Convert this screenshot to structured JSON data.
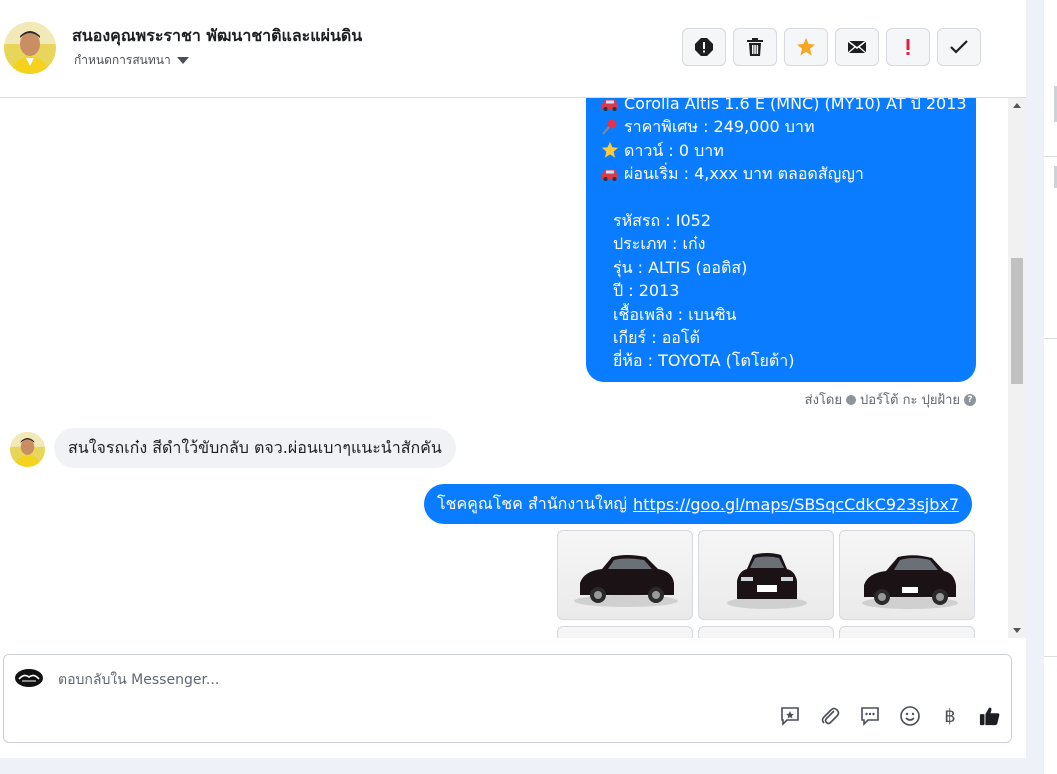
{
  "header": {
    "contact_name": "สนองคุณพระราชา พัฒนาชาติและแผ่นดิน",
    "manage_label": "กำหนดการสนทนา",
    "actions": [
      "alert-circle-icon",
      "trash-icon",
      "star-icon",
      "envelope-icon",
      "exclamation-icon",
      "check-icon"
    ]
  },
  "messages": {
    "listing": {
      "lines": [
        {
          "icon": "car-icon",
          "text": "Corolla Altis 1.6 E (MNC) (MY10) AT ปี 2013"
        },
        {
          "icon": "pushpin-icon",
          "text": "ราคาพิเศษ : 249,000 บาท"
        },
        {
          "icon": "star-icon",
          "text": "ดาวน์ : 0 บาท"
        },
        {
          "icon": "car-icon",
          "text": "ผ่อนเริ่ม : 4,xxx บาท ตลอดสัญญา"
        }
      ],
      "specs": [
        "รหัสรถ : I052",
        "ประเภท : เก๋ง",
        "รุ่น : ALTIS (ออติส)",
        "ปี : 2013",
        "เชื้อเพลิง : เบนซิน",
        "เกียร์ : ออโต้",
        "ยี่ห้อ : TOYOTA (โตโยต้า)"
      ],
      "sent_by_label": "ส่งโดย",
      "sent_by_name": "ปอร์โต้ กะ ปุยฝ้าย",
      "help_mark": "?"
    },
    "incoming": {
      "text": "สนใจรถเก๋ง สีดำใว้ขับกลับ ตจว.ผ่อนเบาๆแนะนำสักคัน"
    },
    "reply": {
      "text": "โชคคูณโชค สำนักงานใหญ่",
      "link": "https://goo.gl/maps/SBSqcCdkC923sjbx7"
    },
    "photos_count": 6
  },
  "composer": {
    "placeholder": "ตอบกลับใน Messenger...",
    "baht_symbol": "฿",
    "tools": [
      "saved-reply-icon",
      "paperclip-icon",
      "chat-bubble-icon",
      "smiley-icon",
      "baht-icon",
      "thumbs-up-icon"
    ]
  },
  "colors": {
    "accent": "#0a7cff",
    "incoming_bubble": "#f0f2f5",
    "star": "#f5a623",
    "danger": "#e41e3f"
  }
}
